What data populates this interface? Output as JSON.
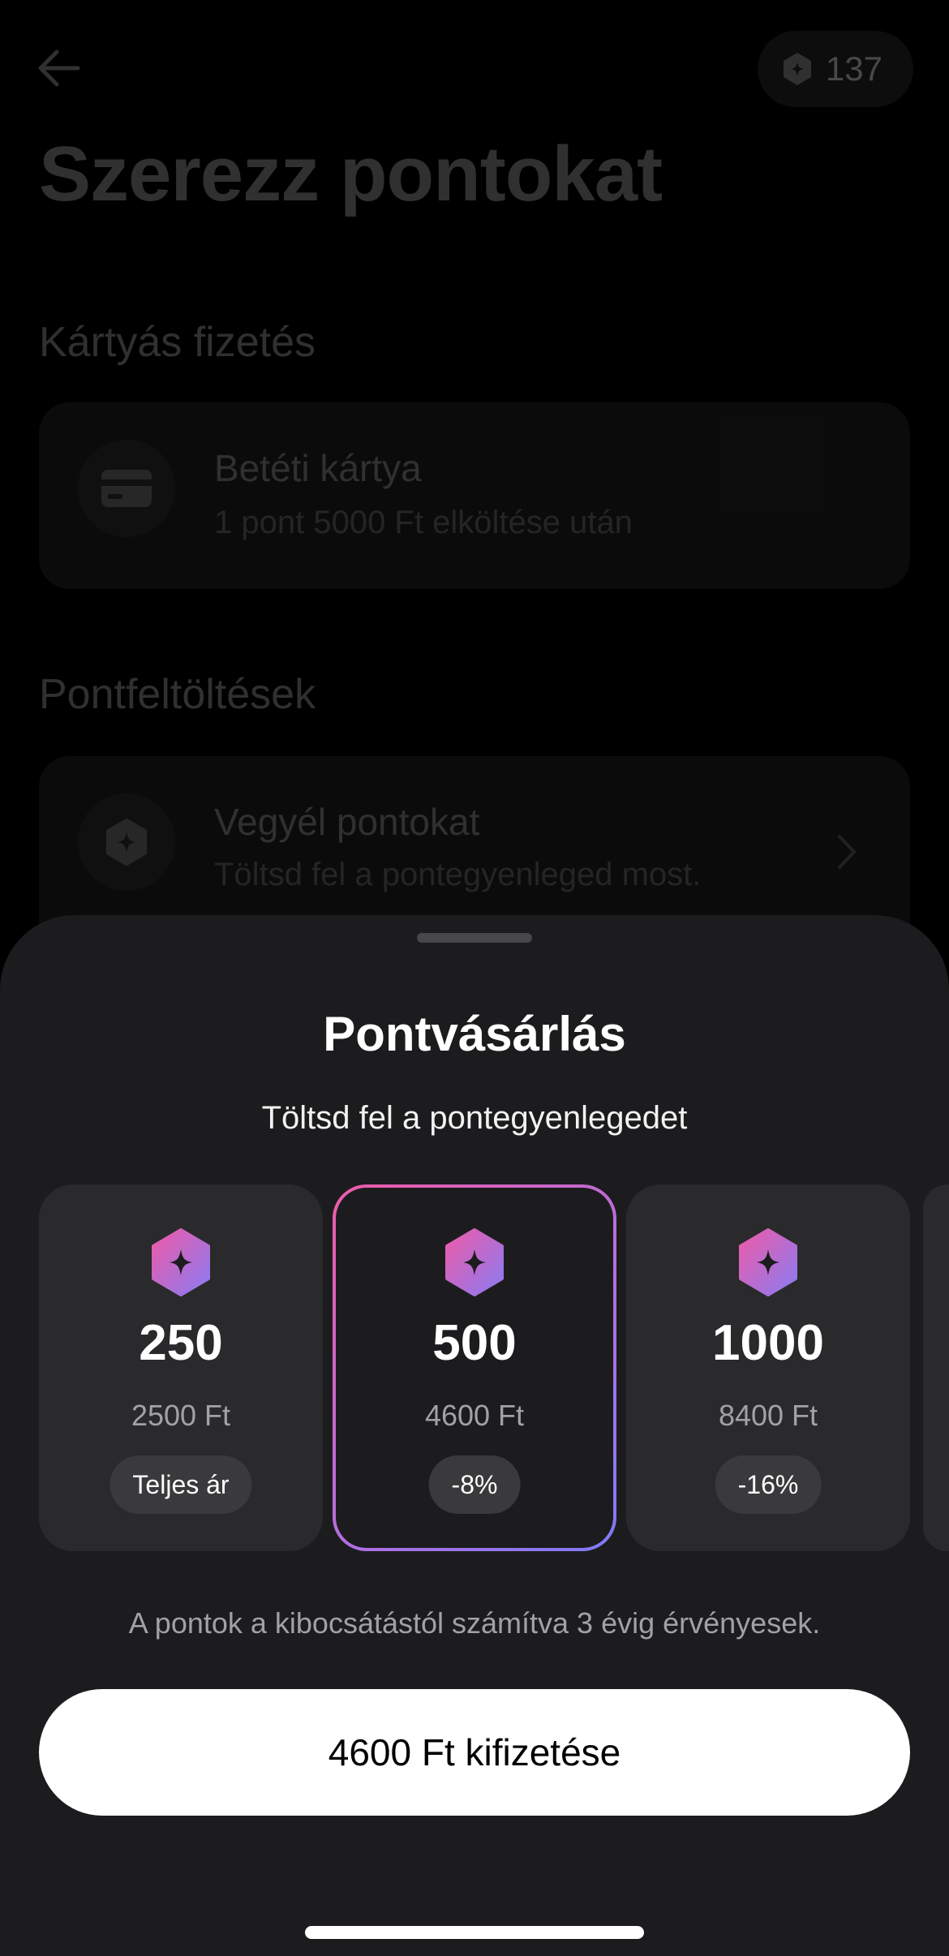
{
  "header": {
    "points_balance": "137",
    "title": "Szerezz pontokat"
  },
  "card_payment": {
    "section_title": "Kártyás fizetés",
    "item": {
      "title": "Betéti kártya",
      "subtitle": "1 pont 5000 Ft elköltése után"
    }
  },
  "topups": {
    "section_title": "Pontfeltöltések",
    "item": {
      "title": "Vegyél pontokat",
      "subtitle": "Töltsd fel a pontegyenleged most."
    }
  },
  "sheet": {
    "title": "Pontvásárlás",
    "subtitle": "Töltsd fel a pontegyenlegedet",
    "packs": [
      {
        "amount": "250",
        "price": "2500 Ft",
        "badge": "Teljes ár",
        "selected": false
      },
      {
        "amount": "500",
        "price": "4600 Ft",
        "badge": "-8%",
        "selected": true
      },
      {
        "amount": "1000",
        "price": "8400 Ft",
        "badge": "-16%",
        "selected": false
      }
    ],
    "validity_note": "A pontok a kibocsátástól számítva 3 évig érvényesek.",
    "pay_button": "4600 Ft kifizetése"
  },
  "colors": {
    "accent_gradient_start": "#ee5ba8",
    "accent_gradient_end": "#7f7bf6",
    "sheet_background": "#1c1c1e",
    "pack_background": "#2a2a2c"
  }
}
